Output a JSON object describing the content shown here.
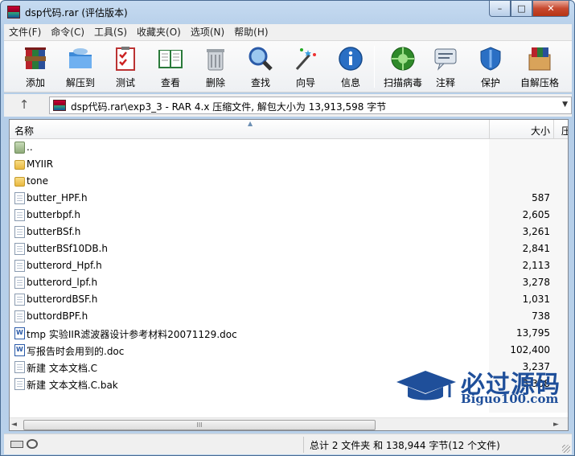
{
  "window": {
    "title": "dsp代码.rar (评估版本)",
    "controls": {
      "minimize": "–",
      "maximize": "□",
      "close": "✕"
    }
  },
  "menu": [
    "文件(F)",
    "命令(C)",
    "工具(S)",
    "收藏夹(O)",
    "选项(N)",
    "帮助(H)"
  ],
  "toolbar": [
    {
      "label": "添加",
      "icon": "add-archive-icon"
    },
    {
      "label": "解压到",
      "icon": "extract-folder-icon"
    },
    {
      "label": "测试",
      "icon": "test-checklist-icon"
    },
    {
      "label": "查看",
      "icon": "view-book-icon"
    },
    {
      "label": "删除",
      "icon": "trash-can-icon"
    },
    {
      "label": "查找",
      "icon": "magnifier-icon"
    },
    {
      "label": "向导",
      "icon": "wizard-wand-icon"
    },
    {
      "label": "信息",
      "icon": "info-icon"
    },
    {
      "label": "扫描病毒",
      "icon": "virus-scan-icon"
    },
    {
      "label": "注释",
      "icon": "comment-icon"
    },
    {
      "label": "保护",
      "icon": "shield-icon"
    },
    {
      "label": "自解压格",
      "icon": "sfx-box-icon"
    }
  ],
  "address": {
    "up": "↑",
    "path": "dsp代码.rar\\exp3_3 - RAR 4.x 压缩文件, 解包大小为 13,913,598 字节",
    "dropdown": "▼"
  },
  "columns": {
    "name": "名称",
    "size": "大小",
    "extra": "压",
    "sort_arrow": "▲"
  },
  "files": [
    {
      "name": "..",
      "size": "",
      "type": "parent"
    },
    {
      "name": "MYIIR",
      "size": "",
      "type": "folder"
    },
    {
      "name": "tone",
      "size": "",
      "type": "folder"
    },
    {
      "name": "butter_HPF.h",
      "size": "587",
      "type": "doc"
    },
    {
      "name": "butterbpf.h",
      "size": "2,605",
      "type": "doc"
    },
    {
      "name": "butterBSf.h",
      "size": "3,261",
      "type": "doc"
    },
    {
      "name": "butterBSf10DB.h",
      "size": "2,841",
      "type": "doc"
    },
    {
      "name": "butterord_Hpf.h",
      "size": "2,113",
      "type": "doc"
    },
    {
      "name": "butterord_lpf.h",
      "size": "3,278",
      "type": "doc"
    },
    {
      "name": "butterordBSF.h",
      "size": "1,031",
      "type": "doc"
    },
    {
      "name": "buttordBPF.h",
      "size": "738",
      "type": "doc"
    },
    {
      "name": "tmp 实验IIR滤波器设计参考材料20071129.doc",
      "size": "13,795",
      "type": "word"
    },
    {
      "name": "写报告时会用到的.doc",
      "size": "102,400",
      "type": "word"
    },
    {
      "name": "新建 文本文档.C",
      "size": "3,237",
      "type": "doc"
    },
    {
      "name": "新建 文本文档.C.bak",
      "size": "3,308",
      "type": "doc"
    }
  ],
  "scrollbar": {
    "left": "◄",
    "grip": "III",
    "right": "►"
  },
  "status": {
    "text": "总计 2 文件夹 和 138,944 字节(12 个文件)"
  },
  "watermark": {
    "title": "必过源码",
    "subtitle": "Biguo100.com"
  },
  "colors": {
    "accent": "#1f4f9a",
    "titlebar": "#b9d1ea",
    "close": "#c7492f"
  }
}
